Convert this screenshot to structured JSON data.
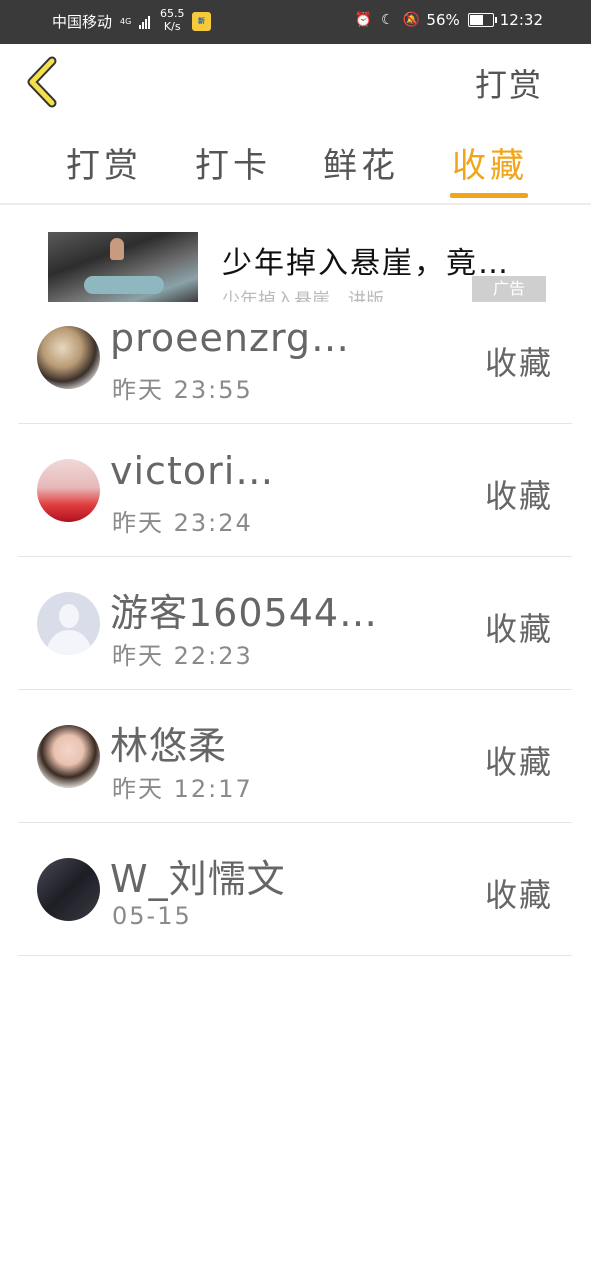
{
  "status_bar": {
    "carrier": "中国移动",
    "network_type": "4G",
    "speed_value": "65.5",
    "speed_unit": "K/s",
    "battery": "56%",
    "time": "12:32"
  },
  "header": {
    "title": "打赏"
  },
  "tabs": [
    {
      "label": "打赏",
      "active": false
    },
    {
      "label": "打卡",
      "active": false
    },
    {
      "label": "鲜花",
      "active": false
    },
    {
      "label": "收藏",
      "active": true
    }
  ],
  "ad": {
    "title": "少年掉入悬崖，竟…",
    "subtitle": "少年掉入悬崖，讲版",
    "badge": "广告"
  },
  "list": [
    {
      "name": "proeenzrg…",
      "time": "昨天 23:55",
      "action": "收藏"
    },
    {
      "name": "victori…",
      "time": "昨天 23:24",
      "action": "收藏"
    },
    {
      "name": "游客160544…",
      "time": "昨天 22:23",
      "action": "收藏"
    },
    {
      "name": "林悠柔",
      "time": "昨天 12:17",
      "action": "收藏"
    },
    {
      "name": "W_刘懦文",
      "time": "05-15",
      "action": "收藏"
    }
  ],
  "colors": {
    "accent": "#f2a51a",
    "status_bar_bg": "#3a3a3a"
  }
}
